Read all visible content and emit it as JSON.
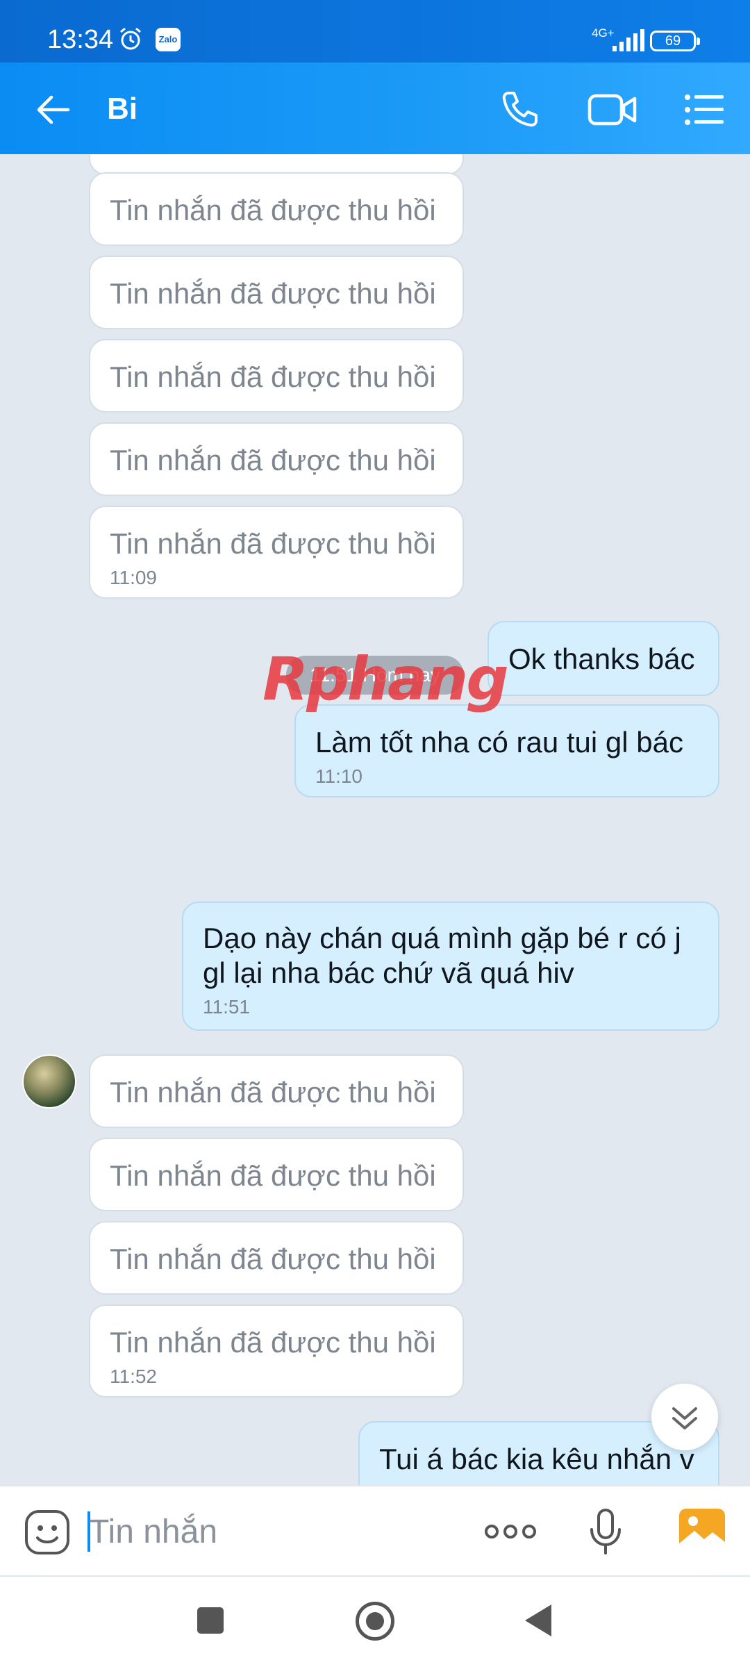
{
  "status_bar": {
    "time": "13:34",
    "app_badge": "Zalo",
    "network": "4G+",
    "battery": "69"
  },
  "header": {
    "title": "Bi"
  },
  "chat": {
    "recalled_text": "Tin nhắn đã được thu hồi",
    "messages": [
      {
        "type": "received",
        "text": "Tin nhắn đã được thu hồi"
      },
      {
        "type": "received",
        "text": "Tin nhắn đã được thu hồi"
      },
      {
        "type": "received",
        "text": "Tin nhắn đã được thu hồi"
      },
      {
        "type": "received",
        "text": "Tin nhắn đã được thu hồi"
      },
      {
        "type": "received",
        "text": "Tin nhắn đã được thu hồi",
        "time": "11:09"
      },
      {
        "type": "sent",
        "text": "Ok thanks bác"
      },
      {
        "type": "sent",
        "text": "Làm tốt nha có rau tui gl bác",
        "time": "11:10"
      },
      {
        "type": "sent",
        "text": "Dạo này chán quá mình gặp bé r có j gl lại nha bác chứ vã quá hiv",
        "time": "11:51"
      },
      {
        "type": "received",
        "text": "Tin nhắn đã được thu hồi"
      },
      {
        "type": "received",
        "text": "Tin nhắn đã được thu hồi"
      },
      {
        "type": "received",
        "text": "Tin nhắn đã được thu hồi"
      },
      {
        "type": "received",
        "text": "Tin nhắn đã được thu hồi",
        "time": "11:52"
      },
      {
        "type": "sent",
        "text": "Tui á bác kia kêu nhắn v"
      }
    ],
    "date_separator": "11:51 Hôm nay",
    "watermark": "Rphang"
  },
  "composer": {
    "placeholder": "Tin nhắn"
  },
  "colors": {
    "header": "#0a8cf3",
    "chat_bg": "#e2e8f0",
    "sent_bubble": "#d5efff",
    "received_bubble": "#ffffff"
  },
  "icons": [
    "alarm-icon",
    "back-arrow-icon",
    "phone-icon",
    "video-call-icon",
    "list-menu-icon",
    "emoji-icon",
    "more-icon",
    "microphone-icon",
    "gallery-icon",
    "chevron-double-down-icon"
  ]
}
